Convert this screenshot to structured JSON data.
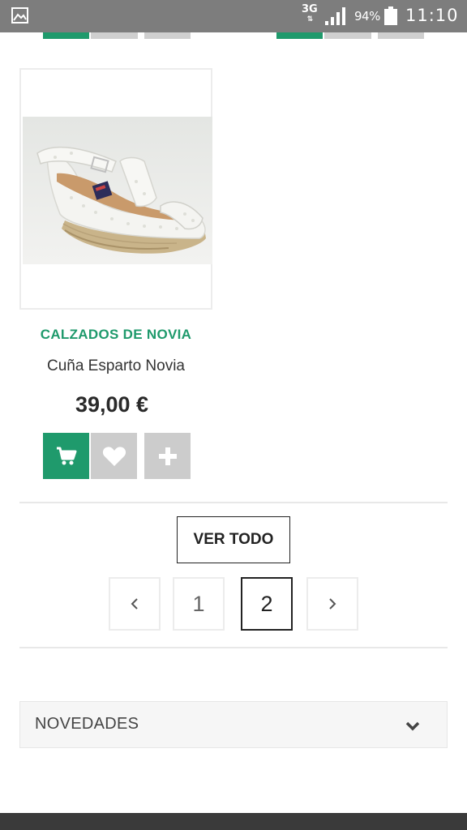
{
  "status_bar": {
    "network": "3G",
    "battery_percent": "94%",
    "time": "11:10",
    "icons": [
      "gallery-icon",
      "signal-icon",
      "battery-icon"
    ]
  },
  "product": {
    "category": "CALZADOS DE NOVIA",
    "name": "Cuña Esparto Novia",
    "price": "39,00 €",
    "image": "white-wedge-espadrille-sandal"
  },
  "actions": {
    "cart_icon": "cart-icon",
    "favorite_icon": "heart-icon",
    "more_icon": "plus-icon"
  },
  "ver_todo_label": "VER TODO",
  "pagination": {
    "prev_icon": "chevron-left-icon",
    "pages": [
      "1",
      "2"
    ],
    "current": "2",
    "next_icon": "chevron-right-icon"
  },
  "accordion": {
    "title": "NOVEDADES",
    "icon": "chevron-down-icon"
  },
  "colors": {
    "accent": "#1f9a6c",
    "neutral_button": "#cccccc",
    "status_bar": "#7d7d7d",
    "footer": "#3a3a3a"
  }
}
